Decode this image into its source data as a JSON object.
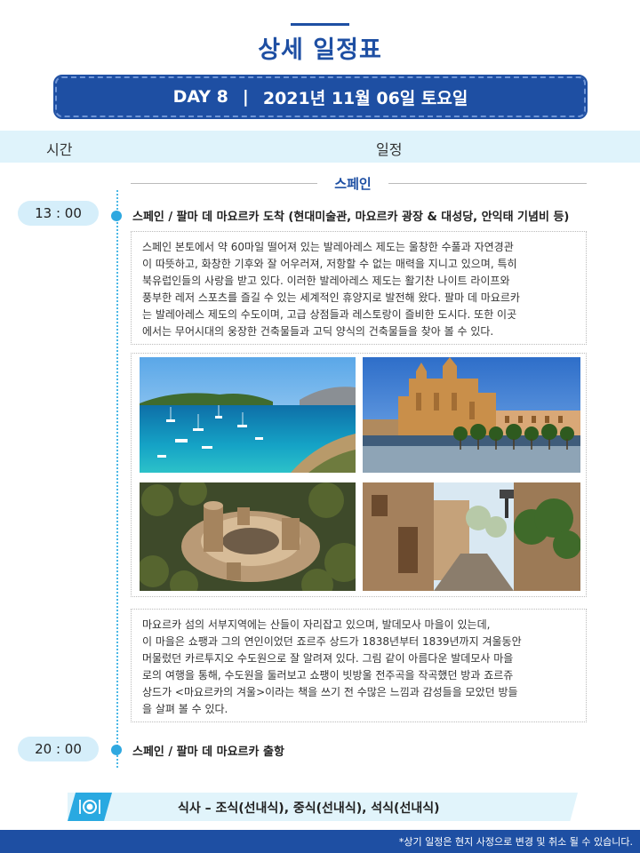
{
  "page": {
    "title": "상세 일정표"
  },
  "banner": {
    "day": "DAY 8",
    "separator": "|",
    "date": "2021년 11월 06일 토요일"
  },
  "columns": {
    "time": "시간",
    "schedule": "일정"
  },
  "region": "스페인",
  "events": [
    {
      "time": "13 : 00",
      "title": "스페인 / 팔마 데 마요르카 도착 (현대미술관, 마요르카 광장 & 대성당, 안익태 기념비 등)"
    },
    {
      "time": "20 : 00",
      "title": "스페인 / 팔마 데 마요르카 출항"
    }
  ],
  "descriptions": [
    [
      "스페인 본토에서 약 60마일 떨어져 있는 발레아레스 제도는 울창한 수풀과 자연경관",
      "이 따뜻하고, 화창한 기후와 잘 어우러져, 저항할 수 없는 매력을 지니고 있으며, 특히",
      "북유럽인들의 사랑을 받고 있다. 이러한 발레아레스 제도는 활기찬 나이트 라이프와",
      "풍부한 레저 스포츠를 즐길 수 있는 세계적인 휴양지로 발전해 왔다. 팔마 데 마요르카",
      "는 발레아레스 제도의 수도이며, 고급 상점들과 레스토랑이 즐비한 도시다. 또한 이곳",
      "에서는 무어시대의 웅장한 건축물들과 고딕 양식의 건축물들을 찾아 볼 수 있다."
    ],
    [
      "마요르카 섬의 서부지역에는 산들이 자리잡고 있으며, 발데모사 마을이 있는데,",
      "이 마을은 쇼팽과 그의 연인이었던 죠르주 상드가 1838년부터 1839년까지  겨울동안",
      "머물렀던 카르투지오 수도원으로 잘 알려져 있다. 그림 같이 아름다운 발데모사 마을",
      "로의 여행을 통해, 수도원을 둘러보고 쇼팽이 빗방울 전주곡을 작곡했던 방과 죠르쥬",
      "상드가 <마요르카의 겨울>이라는 책을 쓰기 전 수많은 느낌과 감성들을 모았던 방들",
      "을 살펴 볼 수 있다."
    ]
  ],
  "photos": [
    "bay-with-boats-photo",
    "palma-cathedral-photo",
    "bellver-castle-photo",
    "valldemossa-street-photo"
  ],
  "meal": {
    "text": "식사 – 조식(선내식),  중식(선내식),  석식(선내식)",
    "icon": "dish-icon"
  },
  "footer": {
    "note": "*상기 일정은  현지 사정으로 변경 및 취소 될 수 있습니다."
  },
  "colors": {
    "primary": "#1e4fa3",
    "accent": "#2fa8e0",
    "light": "#dff3fb"
  }
}
